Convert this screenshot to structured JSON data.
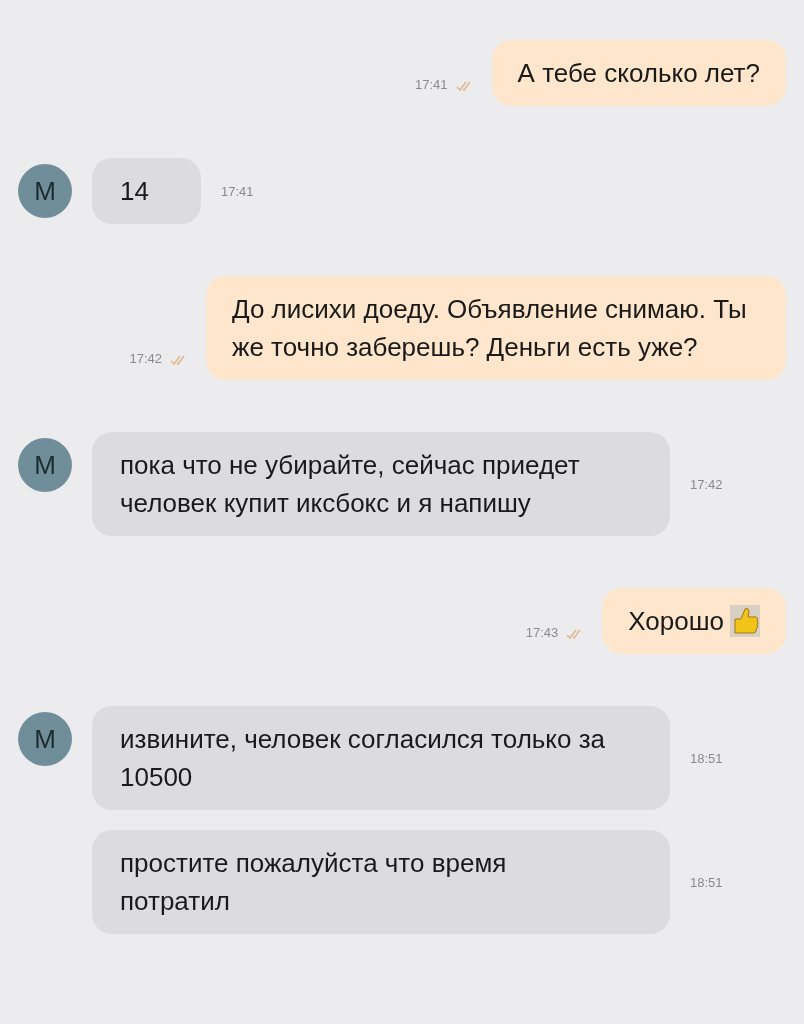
{
  "messages": [
    {
      "kind": "out",
      "text": "А тебе сколько лет?",
      "time": "17:41",
      "read": true
    },
    {
      "kind": "in",
      "avatar": "М",
      "text": "14",
      "time": "17:41"
    },
    {
      "kind": "out",
      "text": "До лисихи доеду. Объявление снимаю. Ты же точно заберешь? Деньги есть уже?",
      "time": "17:42",
      "read": true
    },
    {
      "kind": "in",
      "avatar": "М",
      "text": "пока что не убирайте, сейчас приедет человек купит иксбокс и я напишу",
      "time": "17:42"
    },
    {
      "kind": "out",
      "text": "Хорошо",
      "thumbs_up": true,
      "time": "17:43",
      "read": true
    },
    {
      "kind": "in",
      "avatar": "М",
      "text": "извините, человек согласился только за 10500",
      "time": "18:51"
    },
    {
      "kind": "in",
      "text": "простите пожалуйста что время потратил",
      "time": "18:51"
    }
  ]
}
